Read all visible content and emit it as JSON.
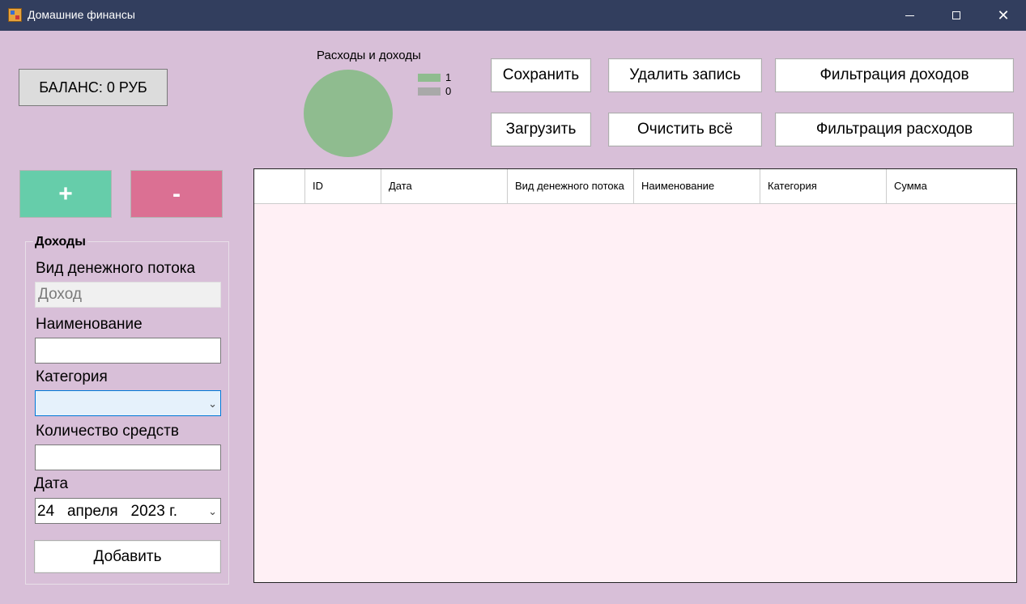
{
  "window": {
    "title": "Домашние финансы",
    "controls": {
      "minimize": "—",
      "close": "✕"
    }
  },
  "balance": {
    "label": "БАЛАНС: 0 РУБ"
  },
  "chart_data": {
    "type": "pie",
    "title": "Расходы и доходы",
    "series": [
      {
        "name": "1",
        "value": 1,
        "color": "#8fbc8f"
      },
      {
        "name": "0",
        "value": 0,
        "color": "#a9a9a9"
      }
    ],
    "legend_position": "top-right"
  },
  "toolbar": {
    "save": "Сохранить",
    "delete_record": "Удалить запись",
    "filter_income": "Фильтрация доходов",
    "load": "Загрузить",
    "clear_all": "Очистить всё",
    "filter_expenses": "Фильтрация расходов"
  },
  "mode_buttons": {
    "plus": "+",
    "minus": "-"
  },
  "colors": {
    "plus": "#66cdaa",
    "minus": "#db7093",
    "background": "#d8bfd8",
    "grid_background": "#fff0f5",
    "titlebar": "#323e5e"
  },
  "form": {
    "group_title": "Доходы",
    "flow_type_label": "Вид денежного потока",
    "flow_type_value": "Доход",
    "name_label": "Наименование",
    "name_value": "",
    "category_label": "Категория",
    "category_value": "",
    "amount_label": "Количество средств",
    "amount_value": "",
    "date_label": "Дата",
    "date_value": "24   апреля   2023 г.",
    "add_button": "Добавить"
  },
  "table": {
    "columns": [
      "",
      "ID",
      "Дата",
      "Вид денежного потока",
      "Наименование",
      "Категория",
      "Сумма"
    ],
    "rows": []
  }
}
